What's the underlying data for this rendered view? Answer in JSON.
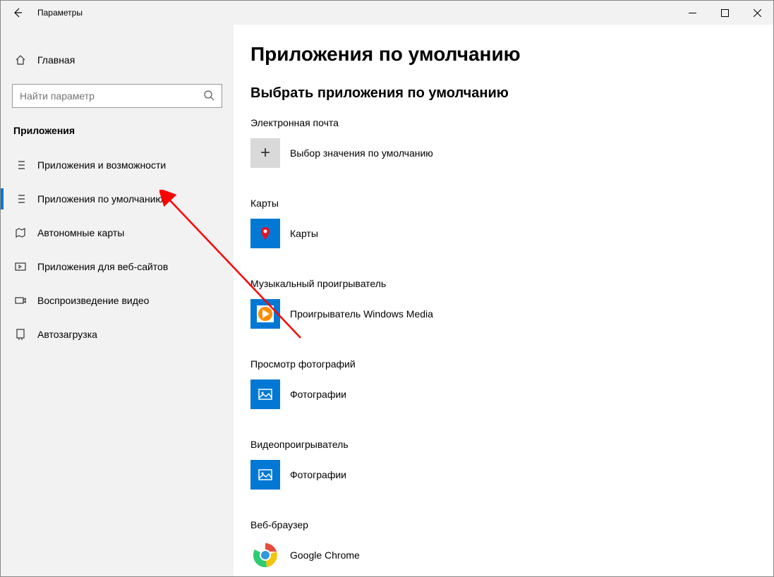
{
  "window": {
    "title": "Параметры"
  },
  "sidebar": {
    "home": "Главная",
    "search_placeholder": "Найти параметр",
    "section": "Приложения",
    "items": [
      {
        "label": "Приложения и возможности",
        "icon": "apps-list-icon"
      },
      {
        "label": "Приложения по умолчанию",
        "icon": "default-apps-icon",
        "selected": true
      },
      {
        "label": "Автономные карты",
        "icon": "offline-maps-icon"
      },
      {
        "label": "Приложения для веб-сайтов",
        "icon": "apps-websites-icon"
      },
      {
        "label": "Воспроизведение видео",
        "icon": "video-playback-icon"
      },
      {
        "label": "Автозагрузка",
        "icon": "startup-icon"
      }
    ]
  },
  "main": {
    "page_title": "Приложения по умолчанию",
    "sub_title": "Выбрать приложения по умолчанию",
    "categories": [
      {
        "label": "Электронная почта",
        "app": "Выбор значения по умолчанию",
        "icon": "plus"
      },
      {
        "label": "Карты",
        "app": "Карты",
        "icon": "maps"
      },
      {
        "label": "Музыкальный проигрыватель",
        "app": "Проигрыватель Windows Media",
        "icon": "wmp"
      },
      {
        "label": "Просмотр фотографий",
        "app": "Фотографии",
        "icon": "photos"
      },
      {
        "label": "Видеопроигрыватель",
        "app": "Фотографии",
        "icon": "photos"
      },
      {
        "label": "Веб-браузер",
        "app": "Google Chrome",
        "icon": "chrome"
      }
    ]
  }
}
